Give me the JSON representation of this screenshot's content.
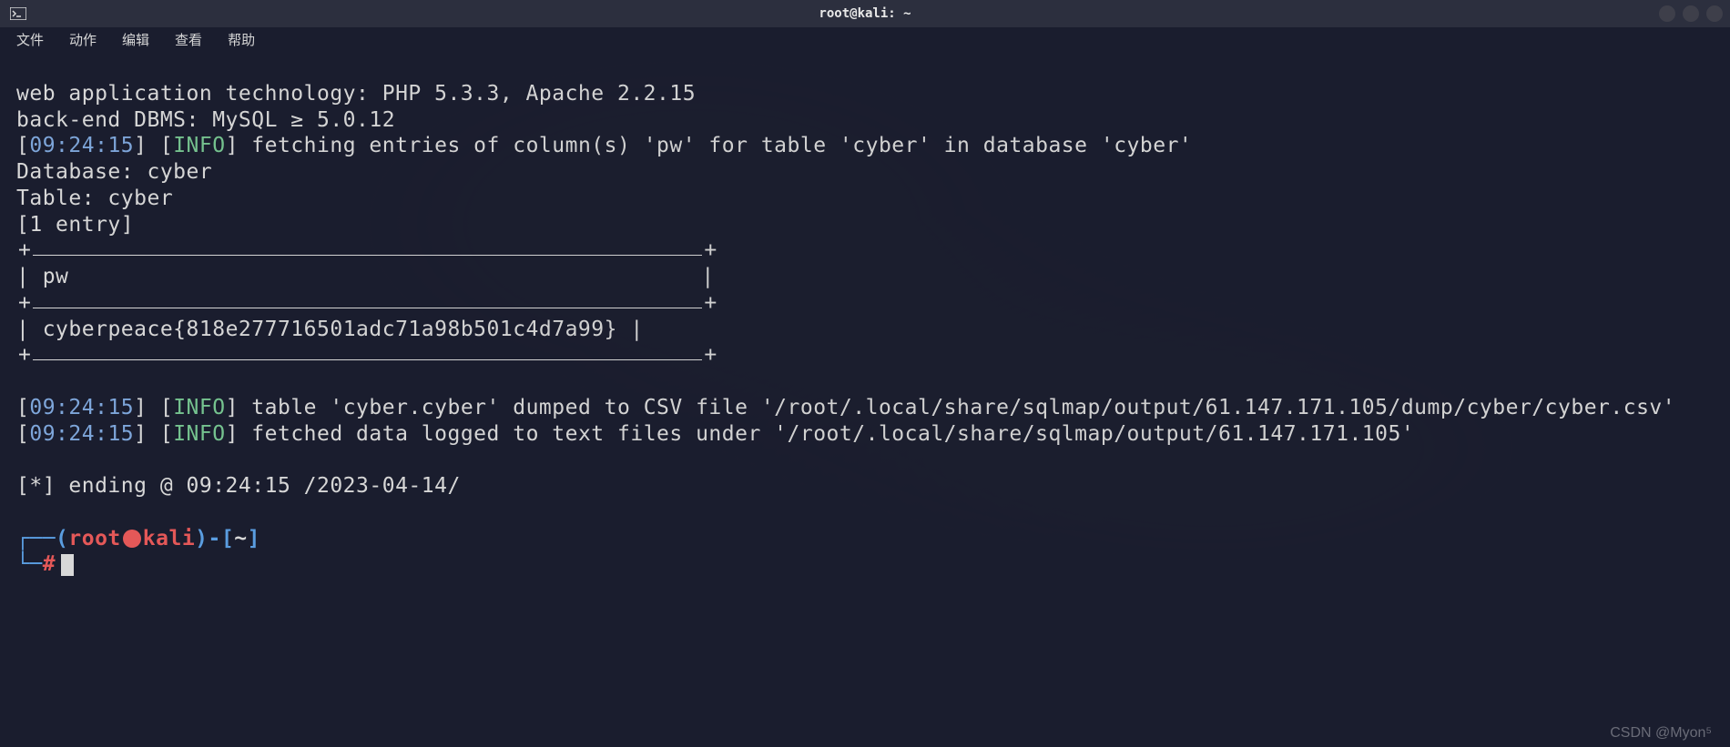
{
  "titlebar": {
    "title": "root@kali: ~"
  },
  "menubar": {
    "items": [
      "文件",
      "动作",
      "编辑",
      "查看",
      "帮助"
    ]
  },
  "lines": {
    "l1": "web application technology: PHP 5.3.3, Apache 2.2.15",
    "l2": "back-end DBMS: MySQL ≥ 5.0.12",
    "ts1": "09:24:15",
    "info": "INFO",
    "l3_rest": "fetching entries of column(s) 'pw' for table 'cyber' in database 'cyber'",
    "l4": "Database: cyber",
    "l5": "Table: cyber",
    "l6": "[1 entry]",
    "col_header": "pw",
    "flag_value": "cyberpeace{818e277716501adc71a98b501c4d7a99}",
    "ts2": "09:24:15",
    "l7_rest": "table 'cyber.cyber' dumped to CSV file '/root/.local/share/sqlmap/output/61.147.171.105/dump/cyber/cyber.csv'",
    "ts3": "09:24:15",
    "l8_rest": "fetched data logged to text files under '/root/.local/share/sqlmap/output/61.147.171.105'",
    "l9": "[*] ending @ 09:24:15 /2023-04-14/"
  },
  "prompt": {
    "root": "root",
    "host": "kali",
    "cwd": "~",
    "hash": "#"
  },
  "watermark": "CSDN @Myon⁵"
}
